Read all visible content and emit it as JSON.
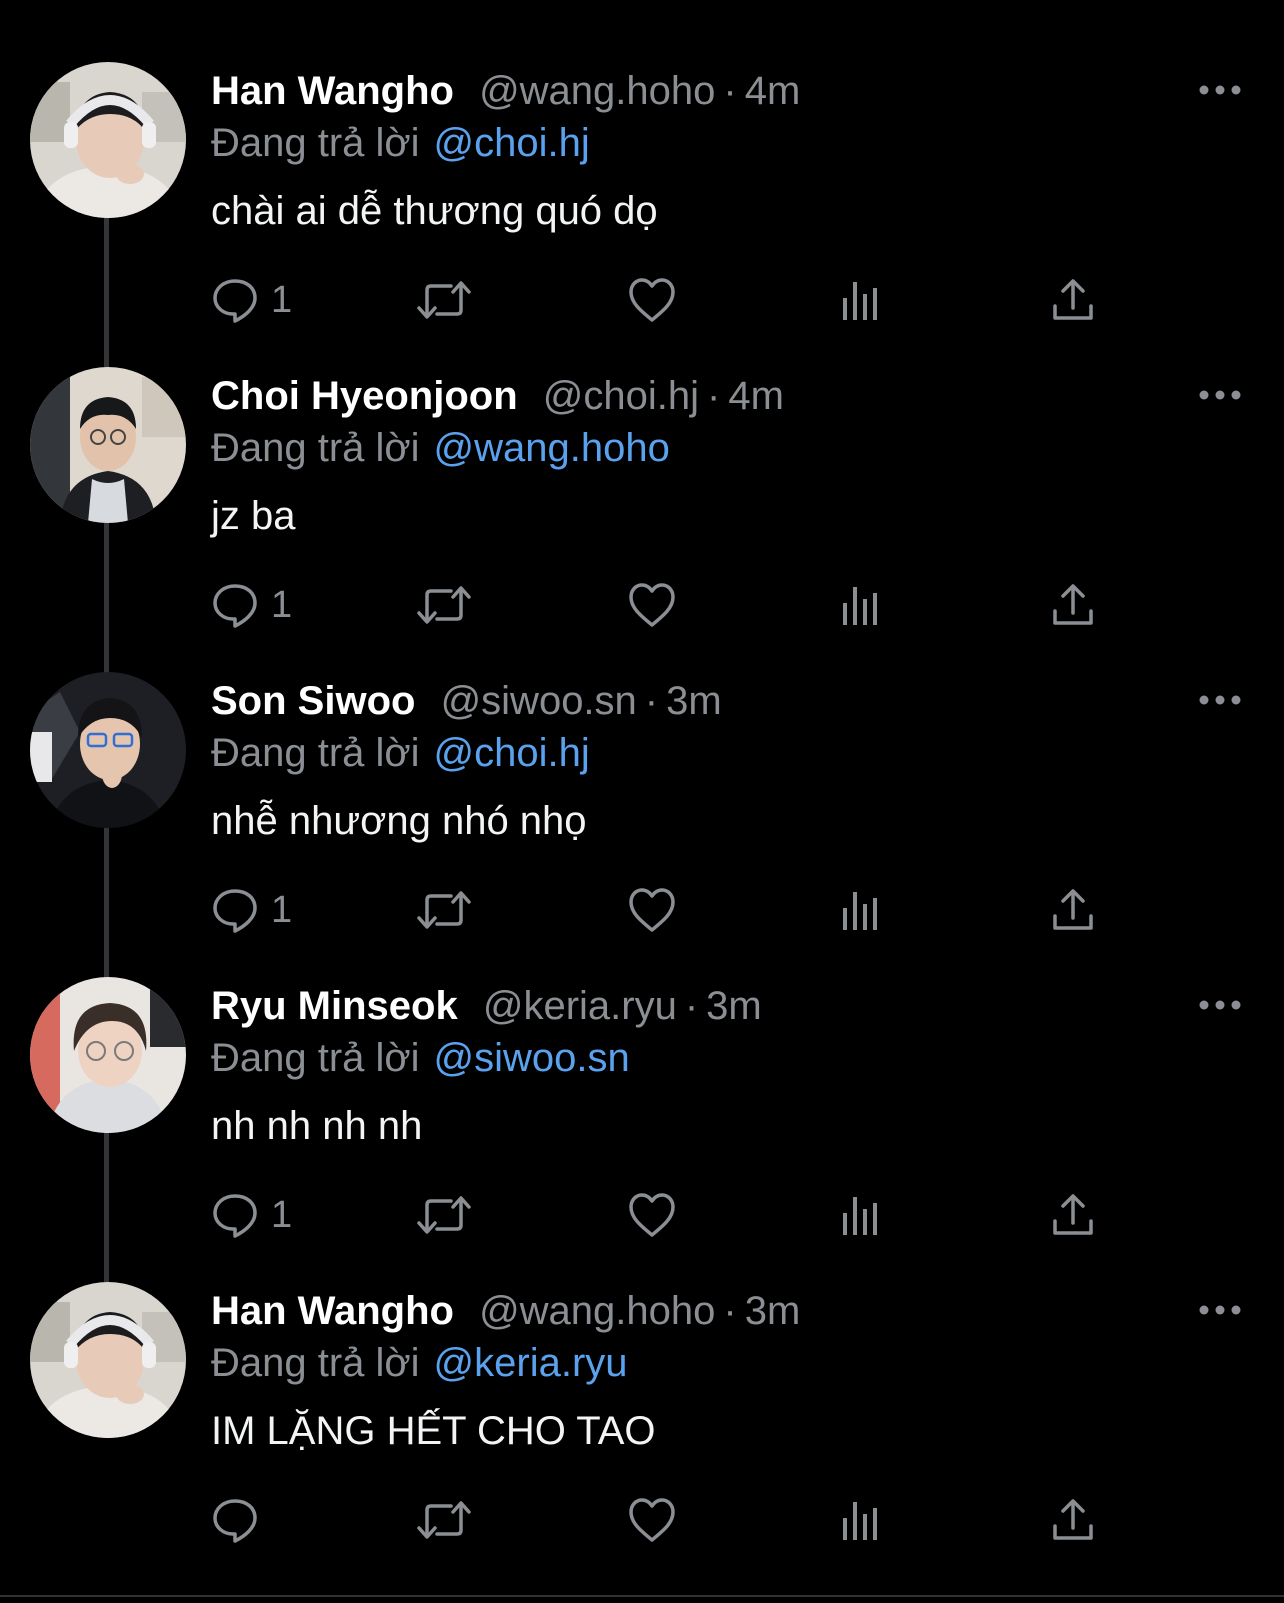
{
  "colors": {
    "background": "#000000",
    "name": "#ffffff",
    "secondary_text": "#8b8f94",
    "mention": "#5aa2ee",
    "icon": "#8b8f94",
    "thread_line": "#333639"
  },
  "icons": {
    "reply": "speech-bubble-icon",
    "retweet": "retweet-arrows-icon",
    "like": "heart-icon",
    "views": "bar-chart-icon",
    "share": "upload-share-icon",
    "more": "three-dots-icon"
  },
  "tweets": [
    {
      "name": "Han Wangho",
      "handle": "@wang.hoho",
      "separator": "·",
      "time": "4m",
      "reply_label": "Đang trả lời",
      "reply_to": "@choi.hj",
      "text": "chài ai dễ thương quó dọ",
      "reply_count": "1"
    },
    {
      "name": "Choi Hyeonjoon",
      "handle": "@choi.hj",
      "separator": "·",
      "time": "4m",
      "reply_label": "Đang trả lời",
      "reply_to": "@wang.hoho",
      "text": "jz ba",
      "reply_count": "1"
    },
    {
      "name": "Son Siwoo",
      "handle": "@siwoo.sn",
      "separator": "·",
      "time": "3m",
      "reply_label": "Đang trả lời",
      "reply_to": "@choi.hj",
      "text": "nhễ nhương nhó nhọ",
      "reply_count": "1"
    },
    {
      "name": "Ryu Minseok",
      "handle": "@keria.ryu",
      "separator": "·",
      "time": "3m",
      "reply_label": "Đang trả lời",
      "reply_to": "@siwoo.sn",
      "text": "nh nh nh nh",
      "reply_count": "1"
    },
    {
      "name": "Han Wangho",
      "handle": "@wang.hoho",
      "separator": "·",
      "time": "3m",
      "reply_label": "Đang trả lời",
      "reply_to": "@keria.ryu",
      "text": "IM LẶNG HẾT CHO TAO",
      "reply_count": ""
    }
  ]
}
